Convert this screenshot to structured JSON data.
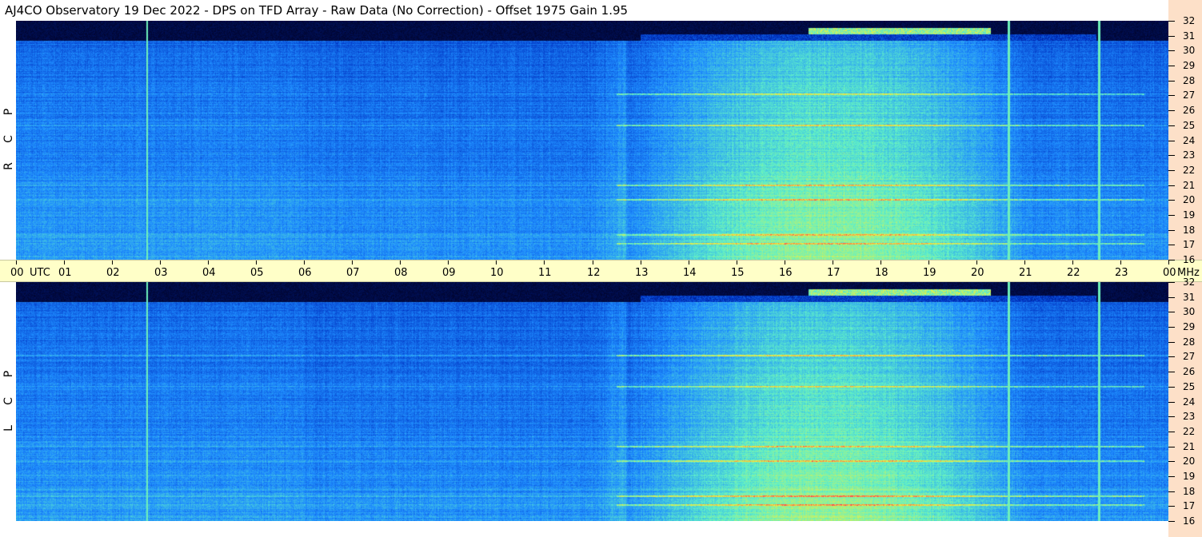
{
  "title": "AJ4CO Observatory  19 Dec 2022  -  DPS on TFD Array  -  Raw Data (No Correction)  -  Offset 1975  Gain 1.95",
  "chart_data": [
    {
      "type": "heatmap",
      "panel": "top",
      "polarization_label": [
        "R",
        "C",
        "P"
      ],
      "x": {
        "unit_label": "UTC",
        "ticks": [
          "00",
          "01",
          "02",
          "03",
          "04",
          "05",
          "06",
          "07",
          "08",
          "09",
          "10",
          "11",
          "12",
          "13",
          "14",
          "15",
          "16",
          "17",
          "18",
          "19",
          "20",
          "21",
          "22",
          "23",
          "00"
        ],
        "range": [
          0,
          24
        ]
      },
      "y": {
        "unit_label": "MHz",
        "ticks": [
          "16",
          "17",
          "18",
          "19",
          "20",
          "21",
          "22",
          "23",
          "24",
          "25",
          "26",
          "27",
          "28",
          "29",
          "30",
          "31",
          "32"
        ],
        "range": [
          16,
          32
        ]
      },
      "vertical_markers_utc": [
        2.72,
        20.67,
        22.55
      ],
      "bright_band_mhz": [
        31.35,
        27.1,
        25.0,
        21.0,
        20.05,
        17.7,
        17.1
      ],
      "activity_start_utc": 12.7,
      "activity_end_utc": 23.3,
      "colormap": [
        "#000020",
        "#0030c0",
        "#1e8cff",
        "#5ff0c8",
        "#f0f03c",
        "#ff3050"
      ]
    },
    {
      "type": "heatmap",
      "panel": "bottom",
      "polarization_label": [
        "L",
        "C",
        "P"
      ],
      "x": {
        "range": [
          0,
          24
        ]
      },
      "y": {
        "ticks": [
          "16",
          "17",
          "18",
          "19",
          "20",
          "21",
          "22",
          "23",
          "24",
          "25",
          "26",
          "27",
          "28",
          "29",
          "30",
          "31",
          "32"
        ],
        "range": [
          16,
          32
        ]
      },
      "vertical_markers_utc": [
        2.72,
        20.67,
        22.55
      ],
      "bright_band_mhz": [
        31.35,
        27.1,
        25.0,
        21.0,
        20.05,
        17.7,
        17.1
      ],
      "activity_start_utc": 12.7,
      "activity_end_utc": 23.3,
      "colormap": [
        "#000020",
        "#0030c0",
        "#1e8cff",
        "#5ff0c8",
        "#f0f03c",
        "#ff3050"
      ]
    }
  ]
}
